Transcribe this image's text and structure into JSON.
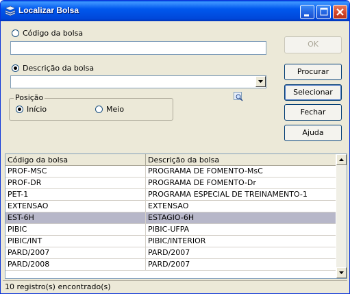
{
  "window": {
    "title": "Localizar Bolsa"
  },
  "search_by_code": {
    "label": "Código da bolsa",
    "value": ""
  },
  "search_by_description": {
    "label": "Descrição da bolsa",
    "value": ""
  },
  "position_group": {
    "title": "Posição",
    "options": [
      "Início",
      "Meio"
    ],
    "selected": "Início"
  },
  "buttons": {
    "ok": "OK",
    "search": "Procurar",
    "select": "Selecionar",
    "close": "Fechar",
    "help": "Ajuda"
  },
  "table": {
    "columns": [
      "Código da bolsa",
      "Descrição da bolsa"
    ],
    "rows": [
      {
        "code": "PROF-MSC",
        "description": "PROGRAMA DE FOMENTO-MsC"
      },
      {
        "code": "PROF-DR",
        "description": "PROGRAMA DE FOMENTO-Dr"
      },
      {
        "code": "PET-1",
        "description": "PROGRAMA ESPECIAL DE TREINAMENTO-1"
      },
      {
        "code": "EXTENSAO",
        "description": "EXTENSAO"
      },
      {
        "code": "EST-6H",
        "description": "ESTAGIO-6H"
      },
      {
        "code": "PIBIC",
        "description": "PIBIC-UFPA"
      },
      {
        "code": "PIBIC/INT",
        "description": "PIBIC/INTERIOR"
      },
      {
        "code": "PARD/2007",
        "description": "PARD/2007"
      },
      {
        "code": "PARD/2008",
        "description": "PARD/2007"
      }
    ],
    "selected_row": 4
  },
  "status": {
    "text": "10 registro(s) encontrado(s)"
  },
  "colors": {
    "titlebar": "#0058ee",
    "selection": "#b7b7c9",
    "window_bg": "#ece9d8"
  }
}
